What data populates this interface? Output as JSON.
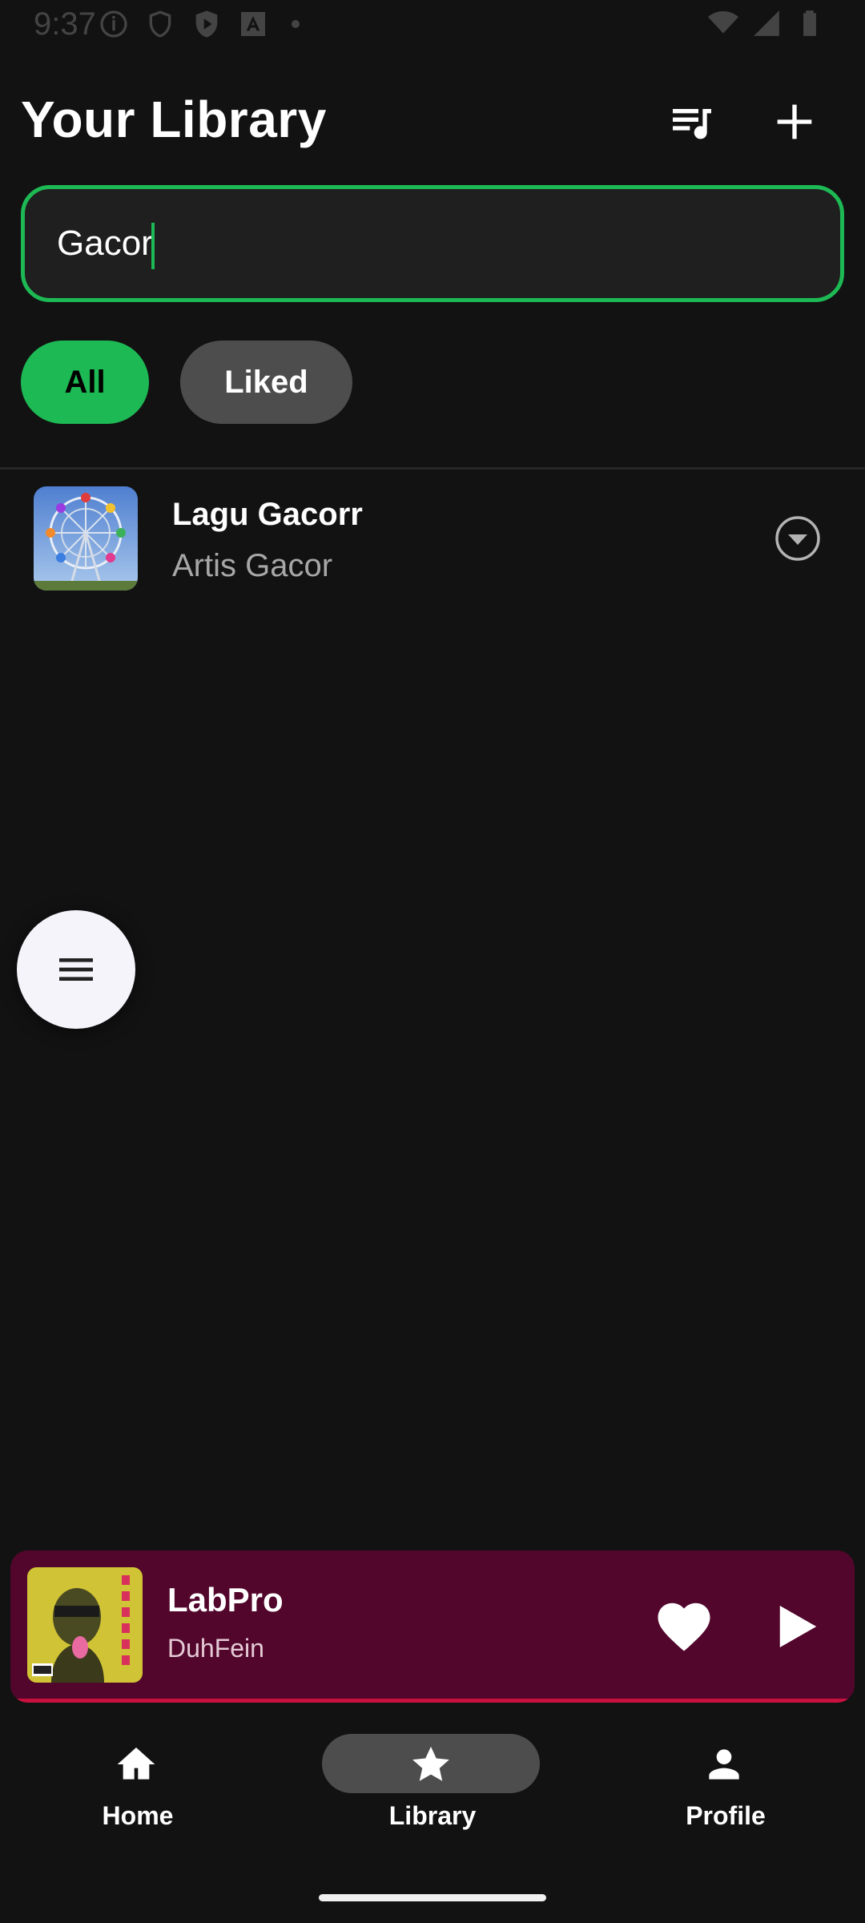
{
  "status_bar": {
    "time": "9:37"
  },
  "header": {
    "title": "Your Library"
  },
  "search": {
    "value": "Gacor",
    "placeholder": ""
  },
  "filters": {
    "chips": [
      {
        "label": "All",
        "selected": true
      },
      {
        "label": "Liked",
        "selected": false
      }
    ]
  },
  "results": [
    {
      "title": "Lagu Gacorr",
      "artist": "Artis Gacor",
      "artwork": "ferris-wheel-artwork"
    }
  ],
  "mini_player": {
    "title": "LabPro",
    "artist": "DuhFein",
    "liked": true,
    "progress": 1.0,
    "colors": {
      "background": "#52062c",
      "progress": "#c9113f"
    }
  },
  "bottom_nav": {
    "items": [
      {
        "label": "Home",
        "icon": "home-icon",
        "active": false
      },
      {
        "label": "Library",
        "icon": "star-icon",
        "active": true
      },
      {
        "label": "Profile",
        "icon": "person-icon",
        "active": false
      }
    ]
  },
  "colors": {
    "accent": "#1db954",
    "background": "#121212"
  }
}
